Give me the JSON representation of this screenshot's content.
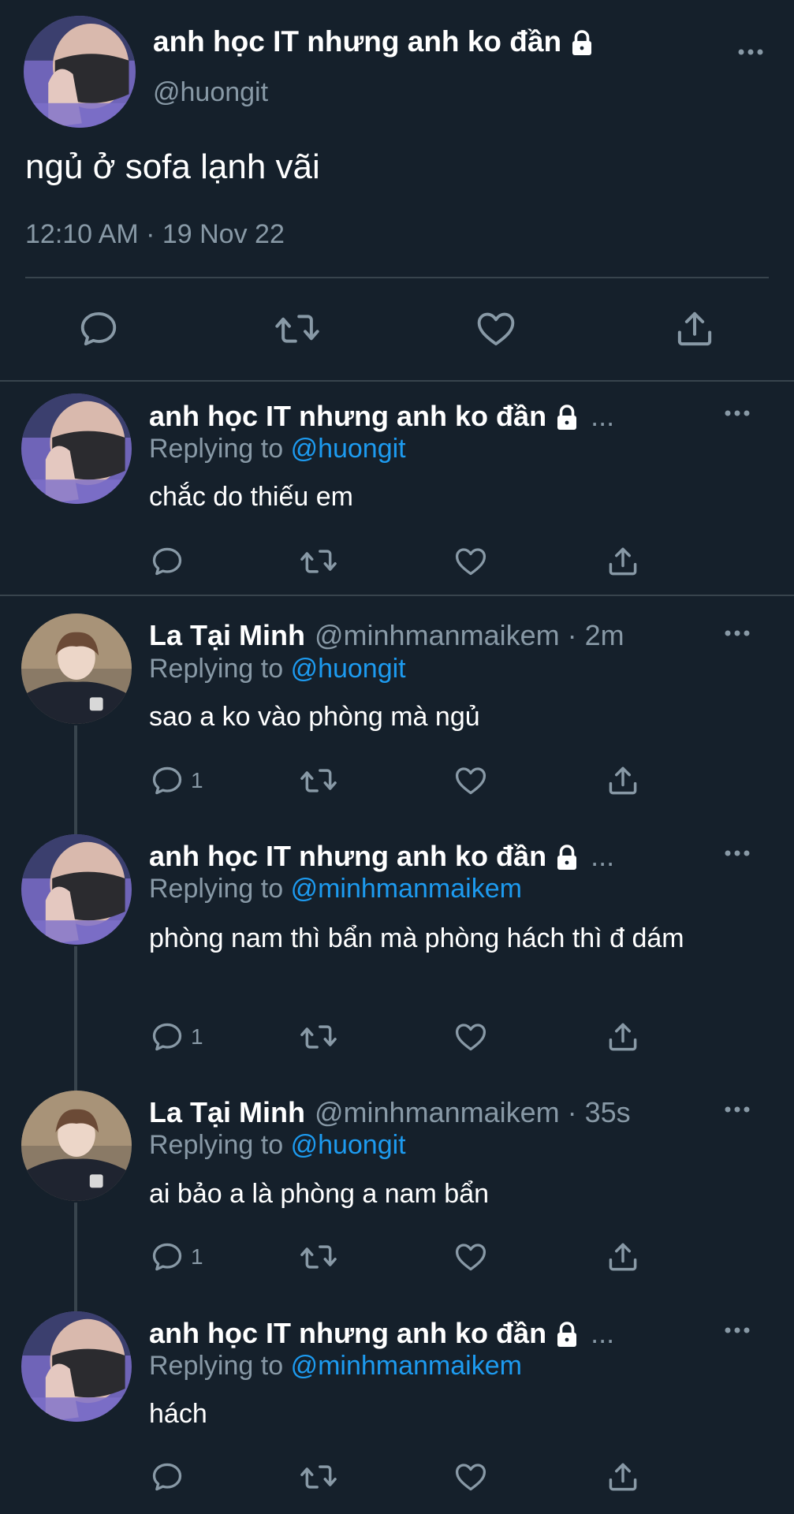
{
  "colors": {
    "background": "#15202b",
    "text": "#ffffff",
    "muted": "#8899a6",
    "accent": "#1d9bf0",
    "divider": "#38444d"
  },
  "main_tweet": {
    "display_name": "anh học IT nhưng anh ko đần",
    "handle": "@huongit",
    "text": "ngủ ở sofa lạnh vãi",
    "timestamp": "12:10 AM · 19 Nov 22",
    "icons": [
      "lock-icon",
      "more-icon",
      "reply-icon",
      "retweet-icon",
      "like-icon",
      "share-icon"
    ]
  },
  "replies": [
    {
      "display_name": "anh học IT nhưng anh ko đần",
      "truncation": "...",
      "replying_prefix": "Replying to",
      "replying_to": "@huongit",
      "text": "chắc do thiếu em",
      "reply_count": ""
    },
    {
      "display_name": "La Tại Minh",
      "handle": "@minhmanmaikem",
      "time": "· 2m",
      "replying_prefix": "Replying to",
      "replying_to": "@huongit",
      "text": "sao a ko vào phòng mà ngủ",
      "reply_count": "1"
    },
    {
      "display_name": "anh học IT nhưng anh ko đần",
      "truncation": "...",
      "replying_prefix": "Replying to",
      "replying_to": "@minhmanmaikem",
      "text": "phòng nam thì bẩn mà phòng hách thì đ dám",
      "reply_count": "1"
    },
    {
      "display_name": "La Tại Minh",
      "handle": "@minhmanmaikem",
      "time": "· 35s",
      "replying_prefix": "Replying to",
      "replying_to": "@huongit",
      "text": "ai bảo a là phòng a nam bẩn",
      "reply_count": "1"
    },
    {
      "display_name": "anh học IT nhưng anh ko đần",
      "truncation": "...",
      "replying_prefix": "Replying to",
      "replying_to": "@minhmanmaikem",
      "text": "hách",
      "reply_count": ""
    }
  ]
}
